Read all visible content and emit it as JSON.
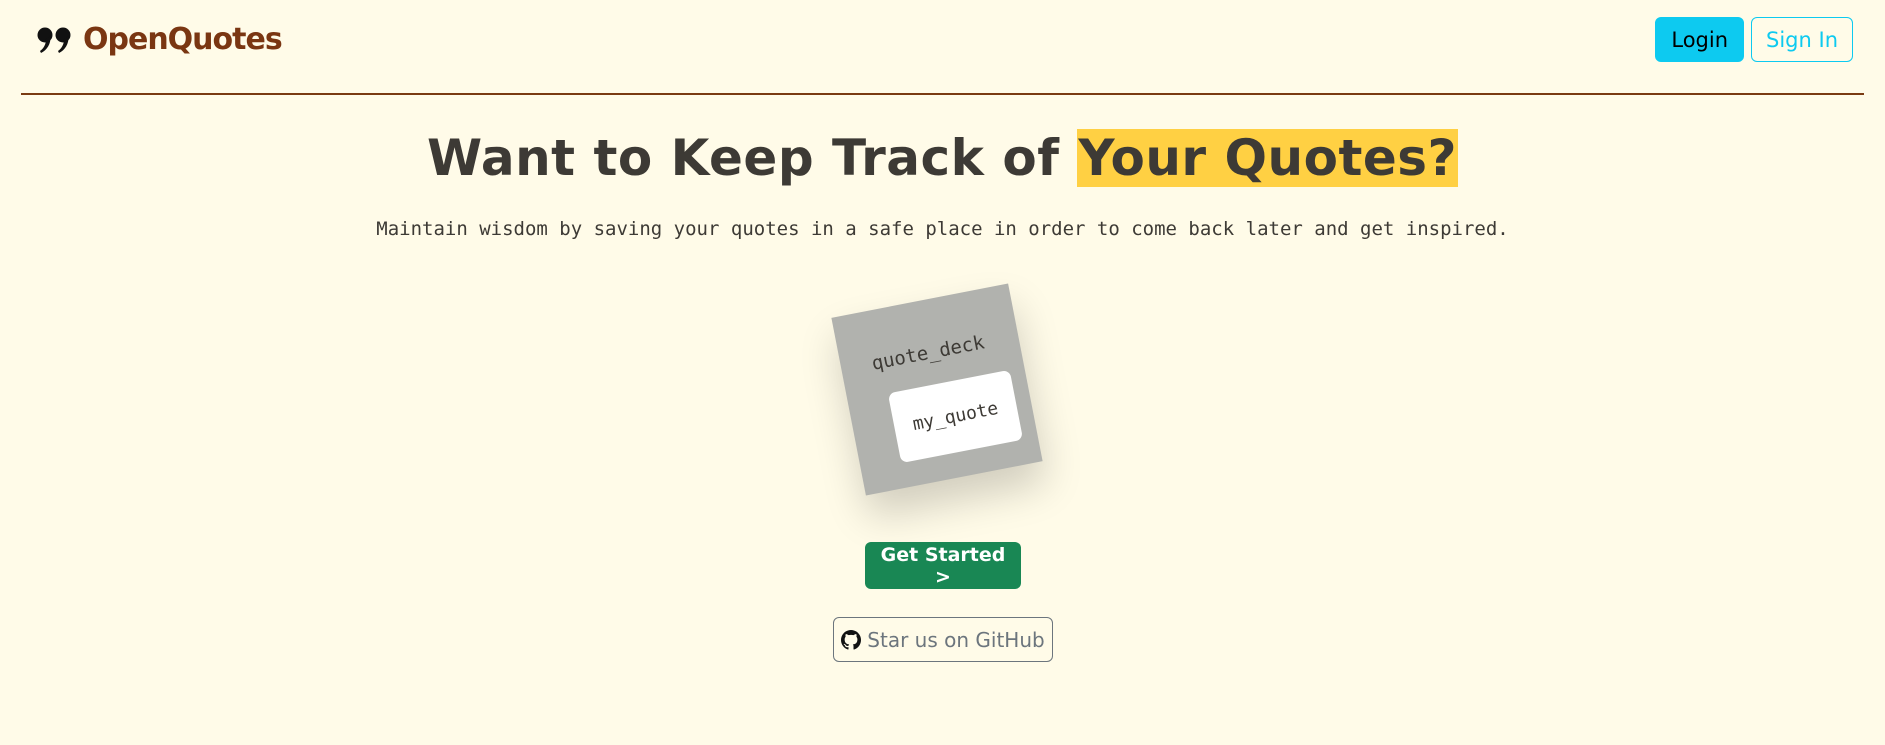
{
  "brand": {
    "name": "OpenQuotes",
    "icon": "quote-marks-icon",
    "color": "#7a3612"
  },
  "nav": {
    "login_label": "Login",
    "signin_label": "Sign In",
    "accent": "#0dcaf0"
  },
  "hero": {
    "title_plain": "Want to Keep Track of ",
    "title_highlight": "Your Quotes?",
    "highlight_color": "#ffd043",
    "subtitle": "Maintain wisdom by saving your quotes in a safe place in order to come back later and get inspired."
  },
  "illustration": {
    "deck_label": "quote_deck",
    "card_label": "my_quote"
  },
  "cta": {
    "get_started_label": "Get Started >",
    "get_started_color": "#198754",
    "github_label": "Star us on GitHub",
    "github_icon": "github-icon"
  },
  "colors": {
    "background": "#fffbe8",
    "text": "#3d3a35",
    "divider": "#7a3b12"
  }
}
